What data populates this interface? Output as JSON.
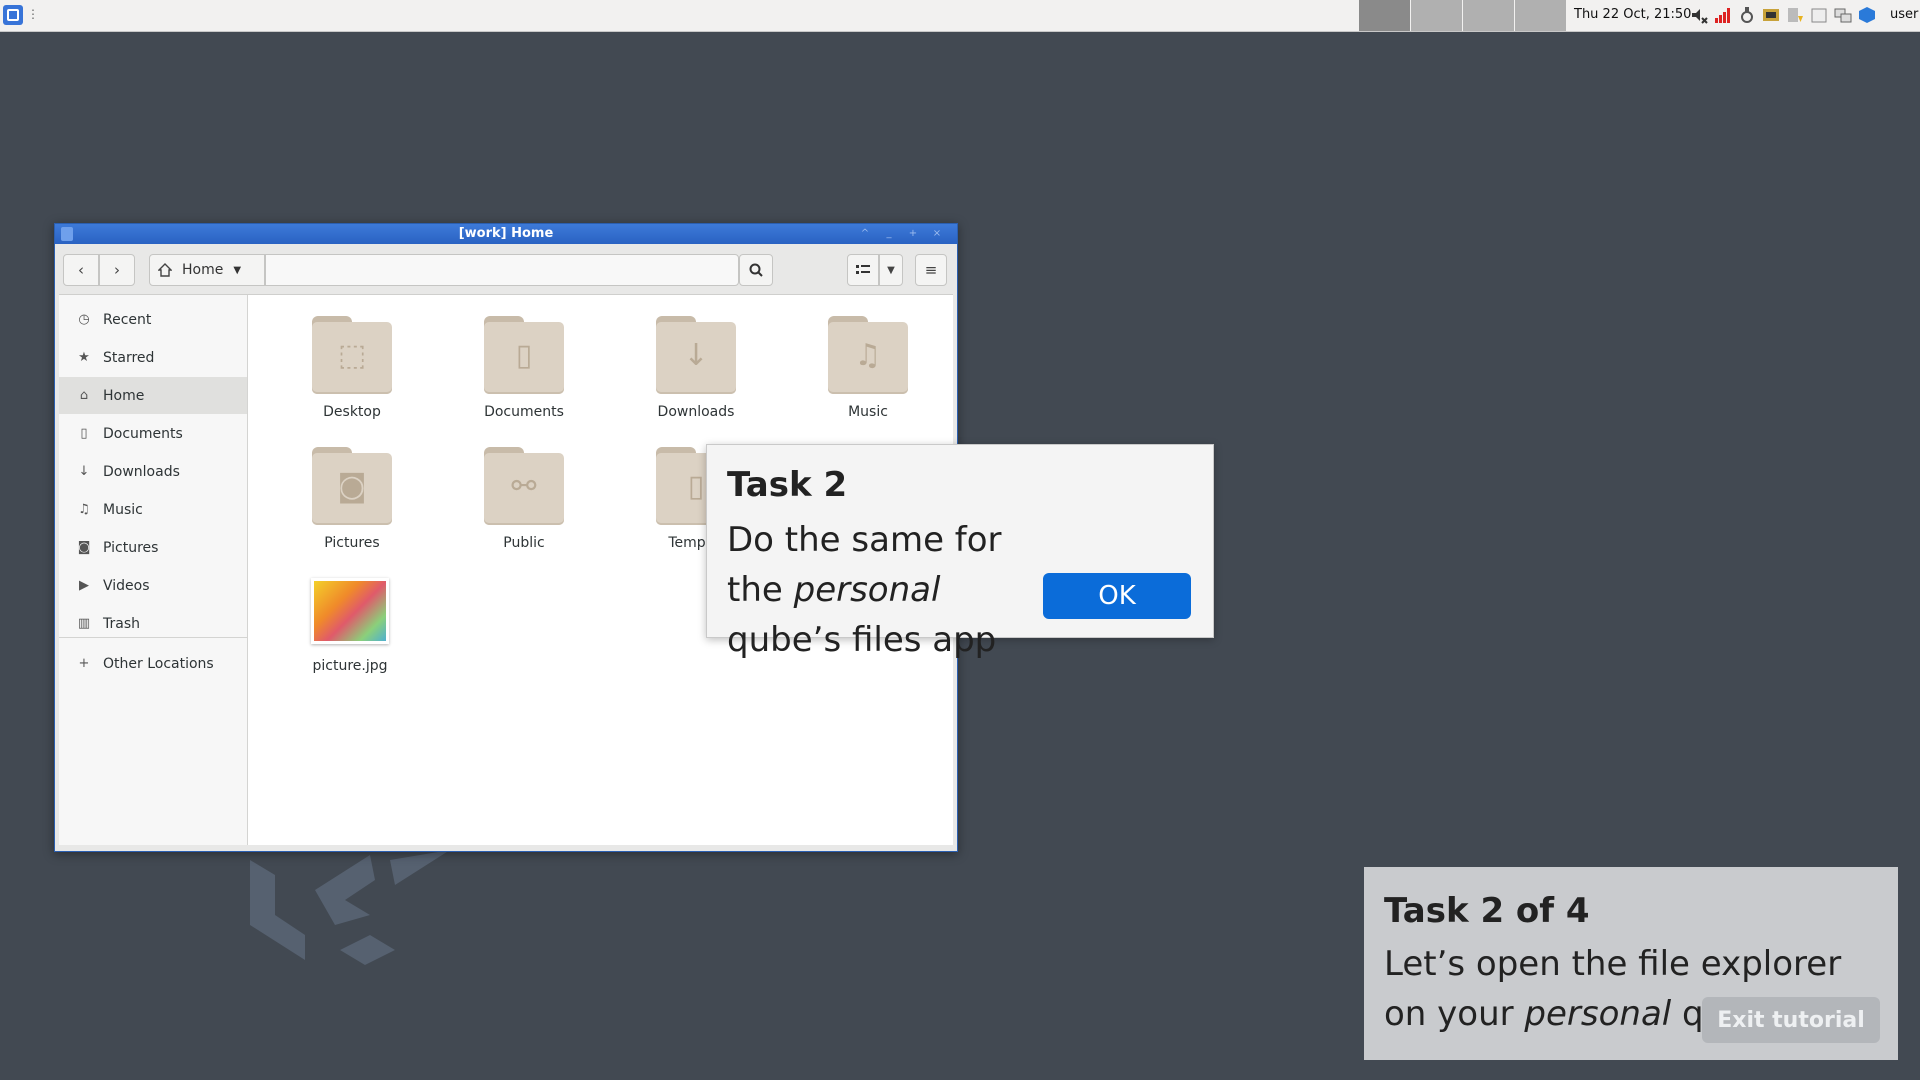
{
  "panel": {
    "clock": "Thu 22 Oct, 21:50",
    "user": "user",
    "workspaces": 4
  },
  "window": {
    "title": "[work] Home",
    "path_label": "Home",
    "sidebar": {
      "items": [
        {
          "label": "Recent",
          "icon": "clock-icon"
        },
        {
          "label": "Starred",
          "icon": "star-icon"
        },
        {
          "label": "Home",
          "icon": "home-icon",
          "selected": true
        },
        {
          "label": "Documents",
          "icon": "document-icon"
        },
        {
          "label": "Downloads",
          "icon": "download-icon"
        },
        {
          "label": "Music",
          "icon": "music-icon"
        },
        {
          "label": "Pictures",
          "icon": "camera-icon"
        },
        {
          "label": "Videos",
          "icon": "video-icon"
        },
        {
          "label": "Trash",
          "icon": "trash-icon"
        }
      ],
      "other": "Other Locations"
    },
    "files": [
      {
        "name": "Desktop",
        "icon": "desktop-folder-icon"
      },
      {
        "name": "Documents",
        "icon": "documents-folder-icon"
      },
      {
        "name": "Downloads",
        "icon": "downloads-folder-icon"
      },
      {
        "name": "Music",
        "icon": "music-folder-icon"
      },
      {
        "name": "Pictures",
        "icon": "pictures-folder-icon"
      },
      {
        "name": "Public",
        "icon": "public-folder-icon"
      },
      {
        "name": "Templat",
        "icon": "templates-folder-icon"
      },
      {
        "name": "picture.jpg",
        "icon": "image-file-icon"
      }
    ]
  },
  "popover": {
    "title": "Task 2",
    "text_before": "Do the same for the ",
    "text_em": "personal",
    "text_after": " qube’s files app",
    "ok": "OK"
  },
  "task_panel": {
    "title": "Task 2 of 4",
    "text_before": "Let’s open the file explorer on your ",
    "text_em": "personal",
    "text_after": " qube",
    "exit": "Exit tutorial"
  },
  "colors": {
    "desktop": "#424952",
    "titlebar": "#2a62c2",
    "ok_button": "#0b6cd9",
    "folder": "#dcd2c4"
  }
}
